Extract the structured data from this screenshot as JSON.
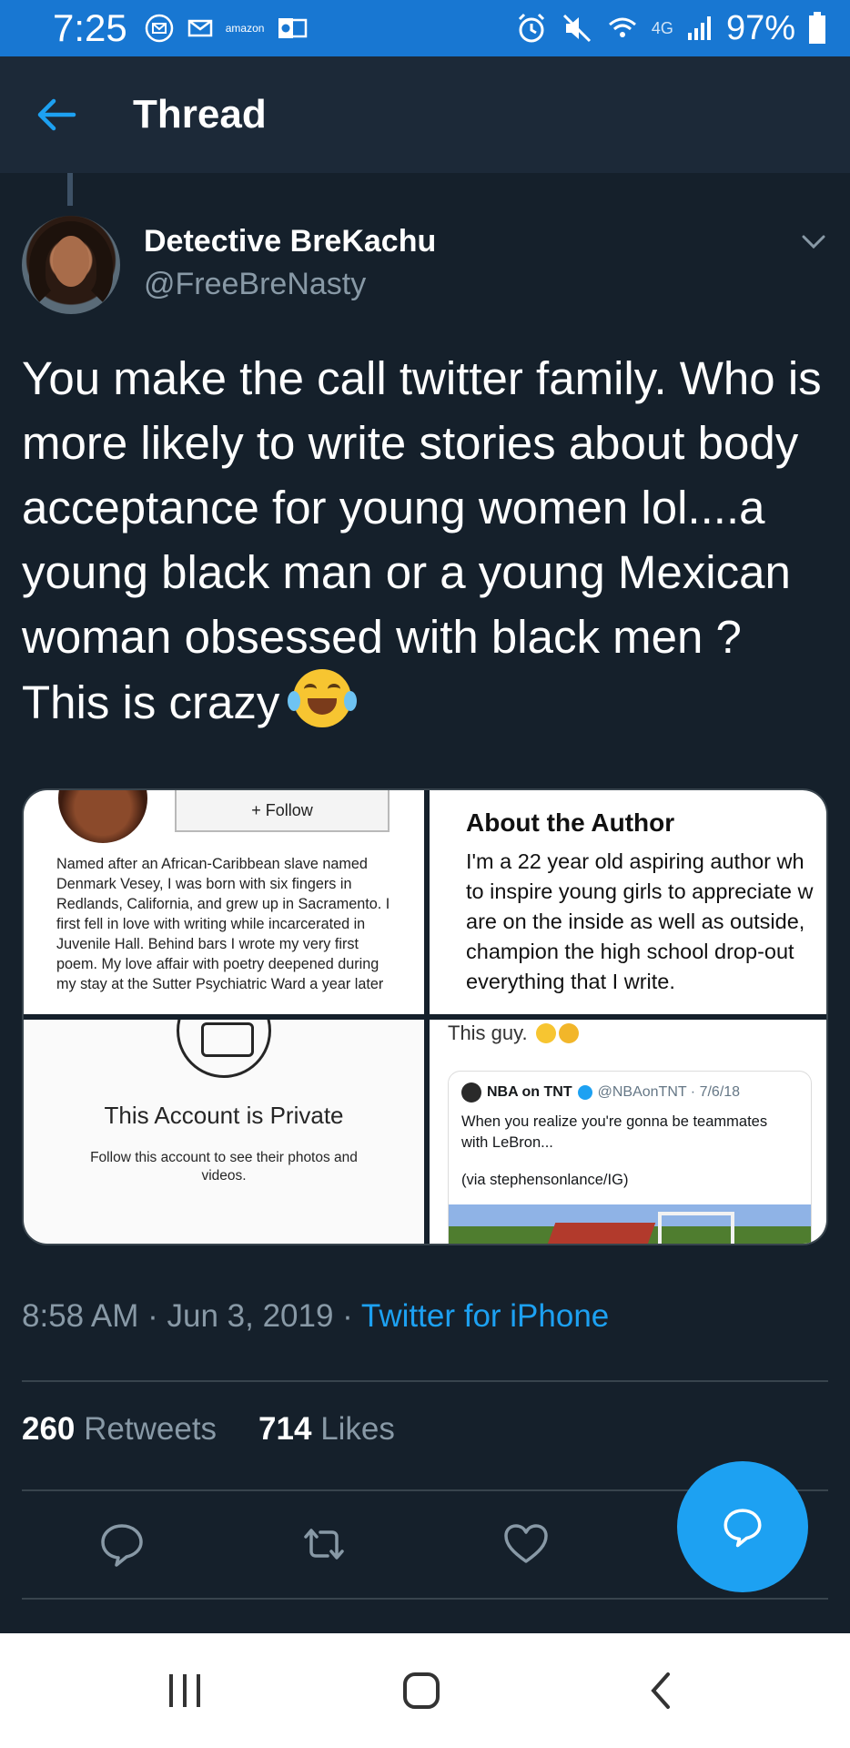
{
  "status_bar": {
    "time": "7:25",
    "battery": "97%",
    "network": "4G",
    "amazon_label": "amazon",
    "background_color": "#1877d2"
  },
  "app_bar": {
    "title": "Thread",
    "back_icon": "arrow-left-icon",
    "accent_color": "#1da1f2"
  },
  "tweet": {
    "author_name": "Detective BreKachu",
    "author_handle": "@FreeBreNasty",
    "text": "You make the call twitter family. Who is more likely to write stories about body acceptance for young women lol....a young black man or a young Mexican woman obsessed with black men ? This is crazy",
    "text_emoji": "face-with-tears-of-joy",
    "timestamp": "8:58 AM · Jun 3, 2019 · ",
    "source": "Twitter for iPhone",
    "retweets_count": "260",
    "retweets_label": "Retweets",
    "likes_count": "714",
    "likes_label": "Likes"
  },
  "media": {
    "cell1": {
      "follow_label": "+ Follow",
      "bio": "Named after an African-Caribbean slave named Denmark Vesey, I was born with six fingers in Redlands, California, and grew up in Sacramento. I first fell in love with writing while incarcerated in Juvenile Hall. Behind bars I wrote my very first poem. My love affair with poetry deepened during my stay at the Sutter Psychiatric Ward a year later"
    },
    "cell2": {
      "title": "About the Author",
      "lines": [
        "I'm a 22 year old aspiring author wh",
        "to inspire young girls to appreciate w",
        "are on the inside as well as outside,",
        "champion the high school drop-out",
        "everything that I write."
      ]
    },
    "cell3": {
      "title": "This Account is Private",
      "subtitle": "Follow this account to see their photos and videos."
    },
    "cell4": {
      "caption": "This guy.",
      "quote_name": "NBA on TNT",
      "quote_meta": "@NBAonTNT · 7/6/18",
      "quote_text": "When you realize you're gonna be teammates with LeBron...",
      "quote_via": "(via stephensonlance/IG)"
    }
  },
  "actions": {
    "reply_icon": "reply-icon",
    "retweet_icon": "retweet-icon",
    "like_icon": "heart-icon",
    "compose_icon": "compose-reply-icon"
  },
  "nav_bar": {
    "recents_icon": "recents-icon",
    "home_icon": "home-icon",
    "back_icon": "back-icon"
  }
}
